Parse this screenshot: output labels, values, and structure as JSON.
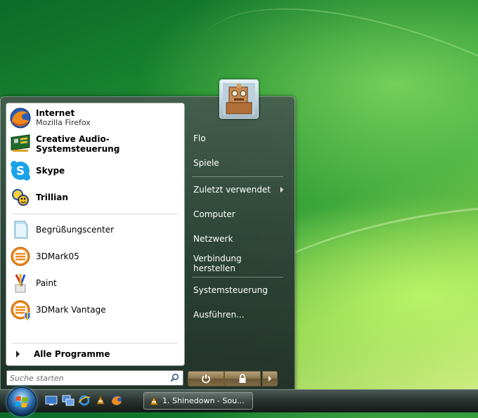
{
  "start_menu": {
    "pinned": [
      {
        "title": "Internet",
        "subtitle": "Mozilla Firefox",
        "icon": "firefox-icon"
      },
      {
        "title": "Creative Audio-Systemsteuerung",
        "icon": "creative-audio-icon"
      }
    ],
    "recent": [
      {
        "title": "Skype",
        "icon": "skype-icon"
      },
      {
        "title": "Trillian",
        "icon": "trillian-icon"
      },
      {
        "title": "Begrüßungscenter",
        "icon": "welcome-center-icon"
      },
      {
        "title": "3DMark05",
        "icon": "3dmark05-icon"
      },
      {
        "title": "Paint",
        "icon": "paint-icon"
      },
      {
        "title": "3DMark Vantage",
        "icon": "3dmark-vantage-icon"
      }
    ],
    "all_programs_label": "Alle Programme",
    "search_placeholder": "Suche starten",
    "right_items": {
      "user": "Flo",
      "games": "Spiele",
      "recent": "Zuletzt verwendet",
      "computer": "Computer",
      "network": "Netzwerk",
      "connect": "Verbindung herstellen",
      "control_panel": "Systemsteuerung",
      "run": "Ausführen..."
    }
  },
  "taskbar": {
    "task_label": "1. Shinedown - Sou..."
  },
  "colors": {
    "accent": "#3b7fbf",
    "menu_bg": "#2f3f3a",
    "power_button": "#8a744c"
  }
}
